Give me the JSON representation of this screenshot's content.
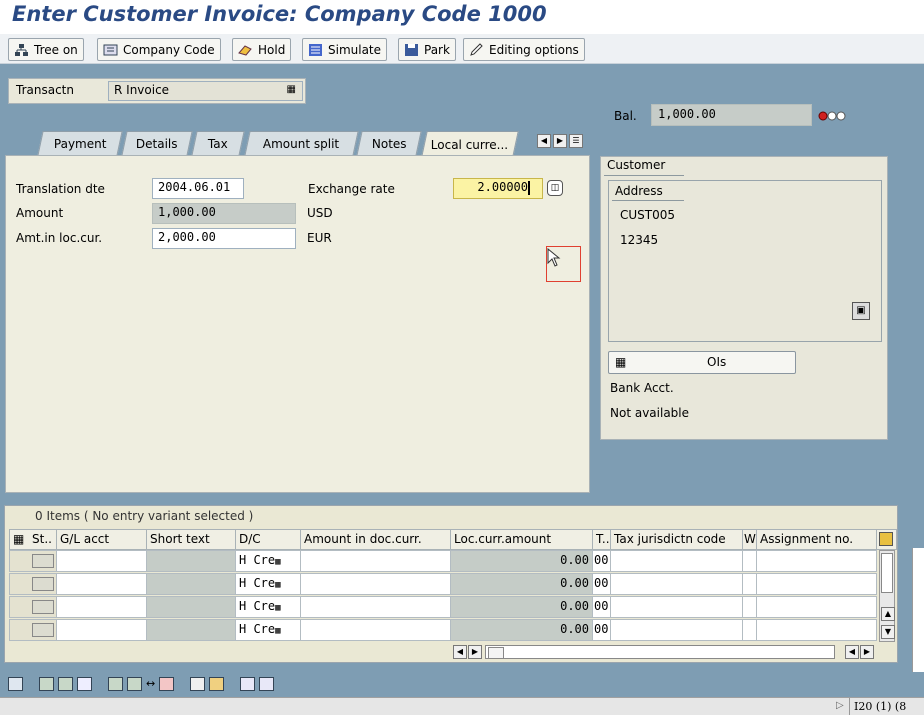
{
  "window": {
    "title": "Enter Customer Invoice: Company Code 1000"
  },
  "toolbar": {
    "buttons": [
      {
        "label": "Tree on",
        "icon": "tree-icon"
      },
      {
        "label": "Company Code",
        "icon": "company-code-icon"
      },
      {
        "label": "Hold",
        "icon": "hold-icon"
      },
      {
        "label": "Simulate",
        "icon": "simulate-icon"
      },
      {
        "label": "Park",
        "icon": "save-icon"
      },
      {
        "label": "Editing options",
        "icon": "pencil-icon"
      }
    ]
  },
  "header": {
    "transaction_label": "Transactn",
    "transaction_value": "R Invoice",
    "balance_label": "Bal.",
    "balance_value": "1,000.00"
  },
  "tabs": [
    {
      "label": "Payment"
    },
    {
      "label": "Details"
    },
    {
      "label": "Tax"
    },
    {
      "label": "Amount split"
    },
    {
      "label": "Notes"
    },
    {
      "label": "Local curre..."
    }
  ],
  "local_currency": {
    "translation_date_label": "Translation dte",
    "translation_date_value": "2004.06.01",
    "amount_label": "Amount",
    "amount_value": "1,000.00",
    "amount_currency": "USD",
    "loc_amount_label": "Amt.in loc.cur.",
    "loc_amount_value": "2,000.00",
    "loc_currency": "EUR",
    "exchange_rate_label": "Exchange rate",
    "exchange_rate_value": "2.00000"
  },
  "customer": {
    "group_label": "Customer",
    "address_label": "Address",
    "customer_id": "CUST005",
    "postal_code": "12345",
    "ois_label": "OIs",
    "bank_label": "Bank Acct.",
    "bank_value": "Not available"
  },
  "items": {
    "caption": "0 Items ( No entry variant selected )",
    "columns": [
      "St..",
      "G/L acct",
      "Short text",
      "D/C",
      "Amount in doc.curr.",
      "Loc.curr.amount",
      "T..",
      "Tax jurisdictn code",
      "W",
      "Assignment no."
    ],
    "rows": [
      {
        "dc": "H Cre",
        "loc_amount": "0.00",
        "t": "00"
      },
      {
        "dc": "H Cre",
        "loc_amount": "0.00",
        "t": "00"
      },
      {
        "dc": "H Cre",
        "loc_amount": "0.00",
        "t": "00"
      },
      {
        "dc": "H Cre",
        "loc_amount": "0.00",
        "t": "00"
      }
    ]
  },
  "status": {
    "session": "I20 (1) (8"
  },
  "colors": {
    "title": "#2a4a84",
    "background": "#7e9db3",
    "panel": "#efeee0",
    "required_field": "#fbf3a4"
  }
}
